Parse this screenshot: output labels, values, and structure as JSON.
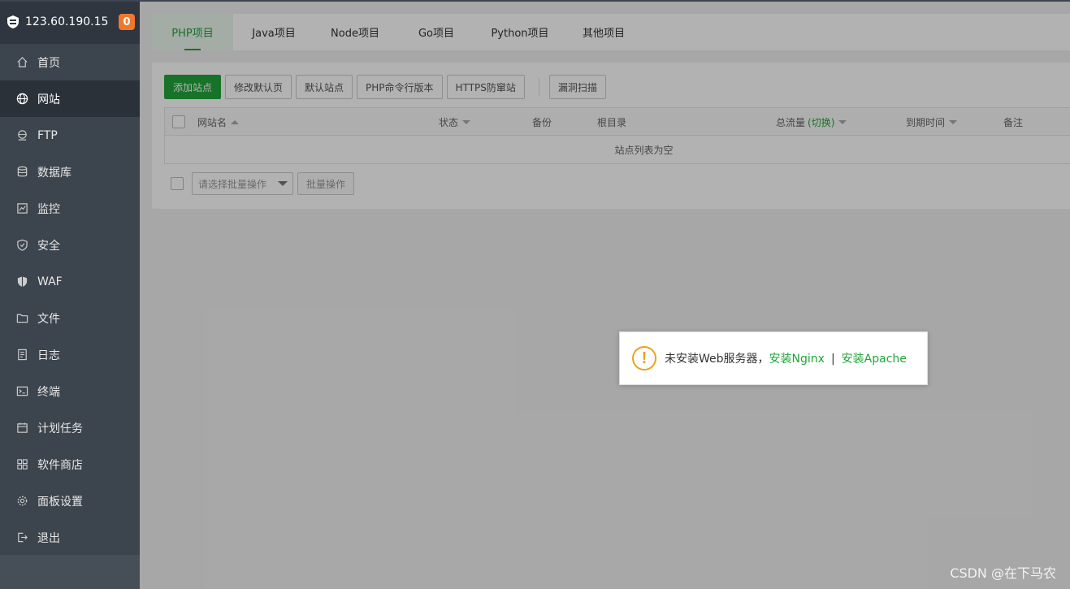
{
  "sidebar": {
    "server_ip": "123.60.190.15",
    "badge_count": "0",
    "items": [
      {
        "label": "首页",
        "icon": "home-icon"
      },
      {
        "label": "网站",
        "icon": "globe-icon",
        "active": true
      },
      {
        "label": "FTP",
        "icon": "ftp-icon"
      },
      {
        "label": "数据库",
        "icon": "database-icon"
      },
      {
        "label": "监控",
        "icon": "monitor-icon"
      },
      {
        "label": "安全",
        "icon": "shield-icon"
      },
      {
        "label": "WAF",
        "icon": "waf-shield-icon"
      },
      {
        "label": "文件",
        "icon": "folder-icon"
      },
      {
        "label": "日志",
        "icon": "log-icon"
      },
      {
        "label": "终端",
        "icon": "terminal-icon"
      },
      {
        "label": "计划任务",
        "icon": "calendar-icon"
      },
      {
        "label": "软件商店",
        "icon": "apps-icon"
      },
      {
        "label": "面板设置",
        "icon": "gear-icon"
      },
      {
        "label": "退出",
        "icon": "logout-icon"
      }
    ]
  },
  "tabs": [
    {
      "label": "PHP项目",
      "active": true
    },
    {
      "label": "Java项目"
    },
    {
      "label": "Node项目"
    },
    {
      "label": "Go项目"
    },
    {
      "label": "Python项目"
    },
    {
      "label": "其他项目"
    }
  ],
  "toolbar": {
    "add_site": "添加站点",
    "edit_default_page": "修改默认页",
    "default_site": "默认站点",
    "php_cli_version": "PHP命令行版本",
    "https_protect": "HTTPS防窜站",
    "vuln_scan": "漏洞扫描"
  },
  "table": {
    "columns": {
      "name": "网站名",
      "status": "状态",
      "backup": "备份",
      "root": "根目录",
      "traffic": "总流量",
      "traffic_switch": "(切换)",
      "expire": "到期时间",
      "note": "备注"
    },
    "empty_text": "站点列表为空"
  },
  "batch": {
    "select_placeholder": "请选择批量操作",
    "button": "批量操作"
  },
  "dialog": {
    "message": "未安装Web服务器，",
    "install_nginx": "安装Nginx",
    "separator": "|",
    "install_apache": "安装Apache"
  },
  "watermark": "CSDN @在下马农",
  "colors": {
    "accent": "#20a53a",
    "sidebar_bg": "#3c444d",
    "badge": "#f0782d",
    "warning": "#f0a020"
  }
}
